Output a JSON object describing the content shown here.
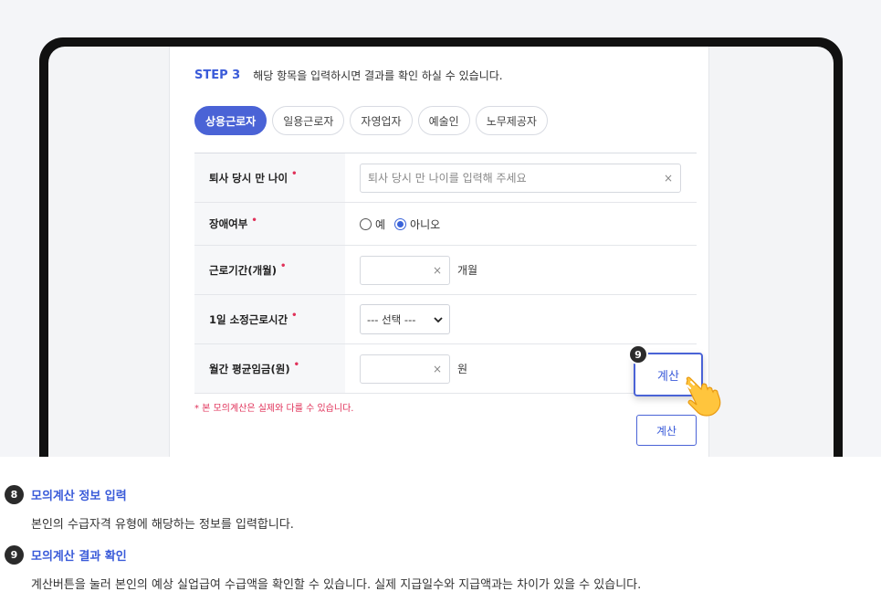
{
  "step": {
    "label": "STEP 3",
    "desc": "해당 항목을 입력하시면 결과를 확인 하실 수 있습니다."
  },
  "tabs": [
    {
      "label": "상용근로자",
      "active": true
    },
    {
      "label": "일용근로자",
      "active": false
    },
    {
      "label": "자영업자",
      "active": false
    },
    {
      "label": "예술인",
      "active": false
    },
    {
      "label": "노무제공자",
      "active": false
    }
  ],
  "form": {
    "age": {
      "label": "퇴사 당시 만 나이",
      "required": "•",
      "placeholder": "퇴사 당시 만 나이를 입력해 주세요",
      "clear": "×"
    },
    "disability": {
      "label": "장애여부",
      "required": "•",
      "options": [
        {
          "label": "예",
          "checked": false
        },
        {
          "label": "아니오",
          "checked": true
        }
      ]
    },
    "period": {
      "label": "근로기간(개월)",
      "required": "•",
      "value": "",
      "clear": "×",
      "unit": "개월"
    },
    "hours": {
      "label": "1일 소정근로시간",
      "required": "•",
      "selected": "--- 선택 ---"
    },
    "wage": {
      "label": "월간 평균임금(원)",
      "required": "•",
      "value": "",
      "clear": "×",
      "unit": "원"
    }
  },
  "note": "* 본 모의계산은 실제와 다를 수 있습니다.",
  "calc_button": "계산",
  "callout": {
    "badge": "9",
    "button": "계산"
  },
  "guide": [
    {
      "badge": "8",
      "title": "모의계산 정보 입력",
      "desc": "본인의 수급자격 유형에 해당하는 정보를 입력합니다."
    },
    {
      "badge": "9",
      "title": "모의계산 결과 확인",
      "desc": "계산버튼을 눌러 본인의 예상 실업급여 수급액을 확인할 수 있습니다. 실제 지급일수와 지급액과는 차이가 있을 수 있습니다."
    }
  ],
  "colors": {
    "accent": "#4a63d6",
    "required": "#e0325a",
    "device": "#111111"
  },
  "icons": {
    "pointer": "pointing-hand-icon",
    "clear": "clear-x-icon",
    "select": "chevron-down-icon"
  }
}
